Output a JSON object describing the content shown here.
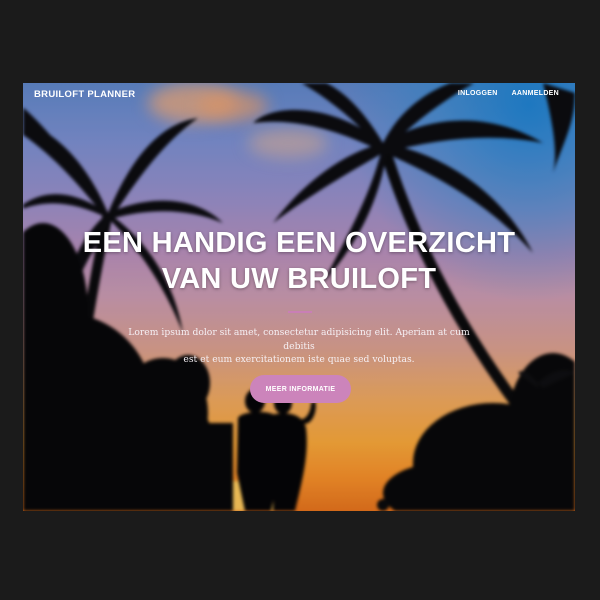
{
  "navbar": {
    "brand": "BRUILOFT PLANNER",
    "links": [
      "INLOGGEN",
      "AANMELDEN"
    ]
  },
  "hero": {
    "title_line1": "EEN HANDIG EEN OVERZICHT",
    "title_line2": "VAN UW BRUILOFT",
    "lead_line1": "Lorem ipsum dolor sit amet, consectetur adipisicing elit. Aperiam at cum debitis",
    "lead_line2": "est et eum exercitationem iste quae sed voluptas.",
    "cta_label": "MEER INFORMATIE"
  },
  "colors": {
    "page_background": "#1b1b1b",
    "accent": "#cc84bb",
    "text": "#ffffff"
  }
}
